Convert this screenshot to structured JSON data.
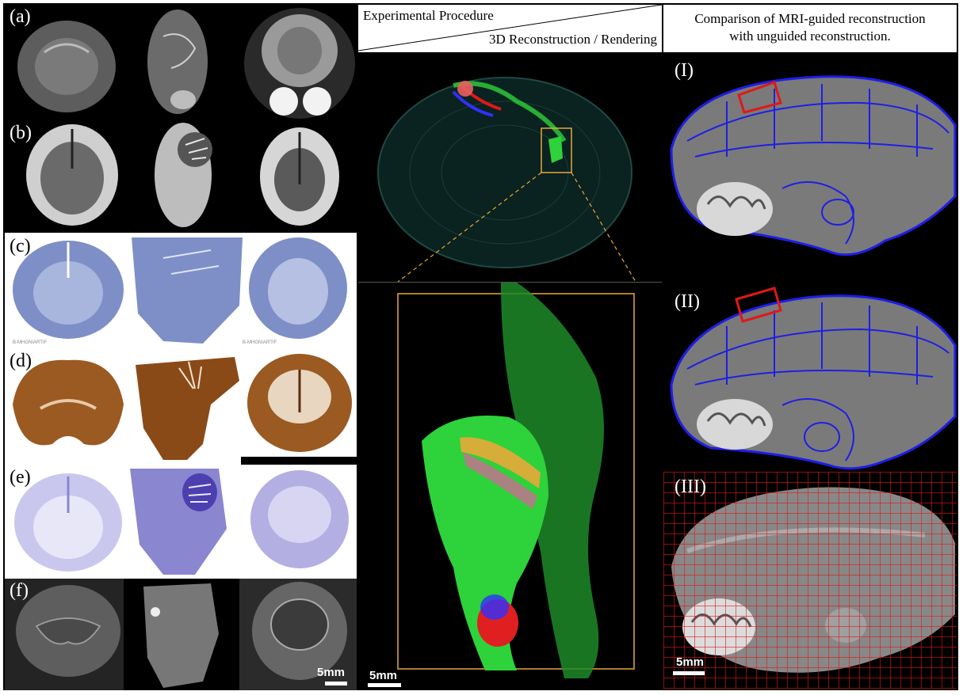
{
  "left_panels": {
    "labels": [
      "(a)",
      "(b)",
      "(c)",
      "(d)",
      "(e)",
      "(f)"
    ],
    "tiny_text": "B-MHGNIARTIF",
    "scale_label": "5mm"
  },
  "middle": {
    "header_top": "Experimental Procedure",
    "header_bottom": "3D Reconstruction / Rendering",
    "scale_label": "5mm"
  },
  "right": {
    "header_line1": "Comparison of MRI-guided reconstruction",
    "header_line2": "with unguided reconstruction.",
    "labels": [
      "(I)",
      "(II)",
      "(III)"
    ],
    "scale_label": "5mm"
  },
  "colors": {
    "blue_outline": "#1e1ee6",
    "red_outline": "#e01818",
    "green_fluor": "#2ed23a",
    "orange_box": "#e8a838",
    "nissl_blue": "#7d8fc6",
    "brown_stain": "#9a5a22",
    "violet_stain": "#8a86d0"
  }
}
